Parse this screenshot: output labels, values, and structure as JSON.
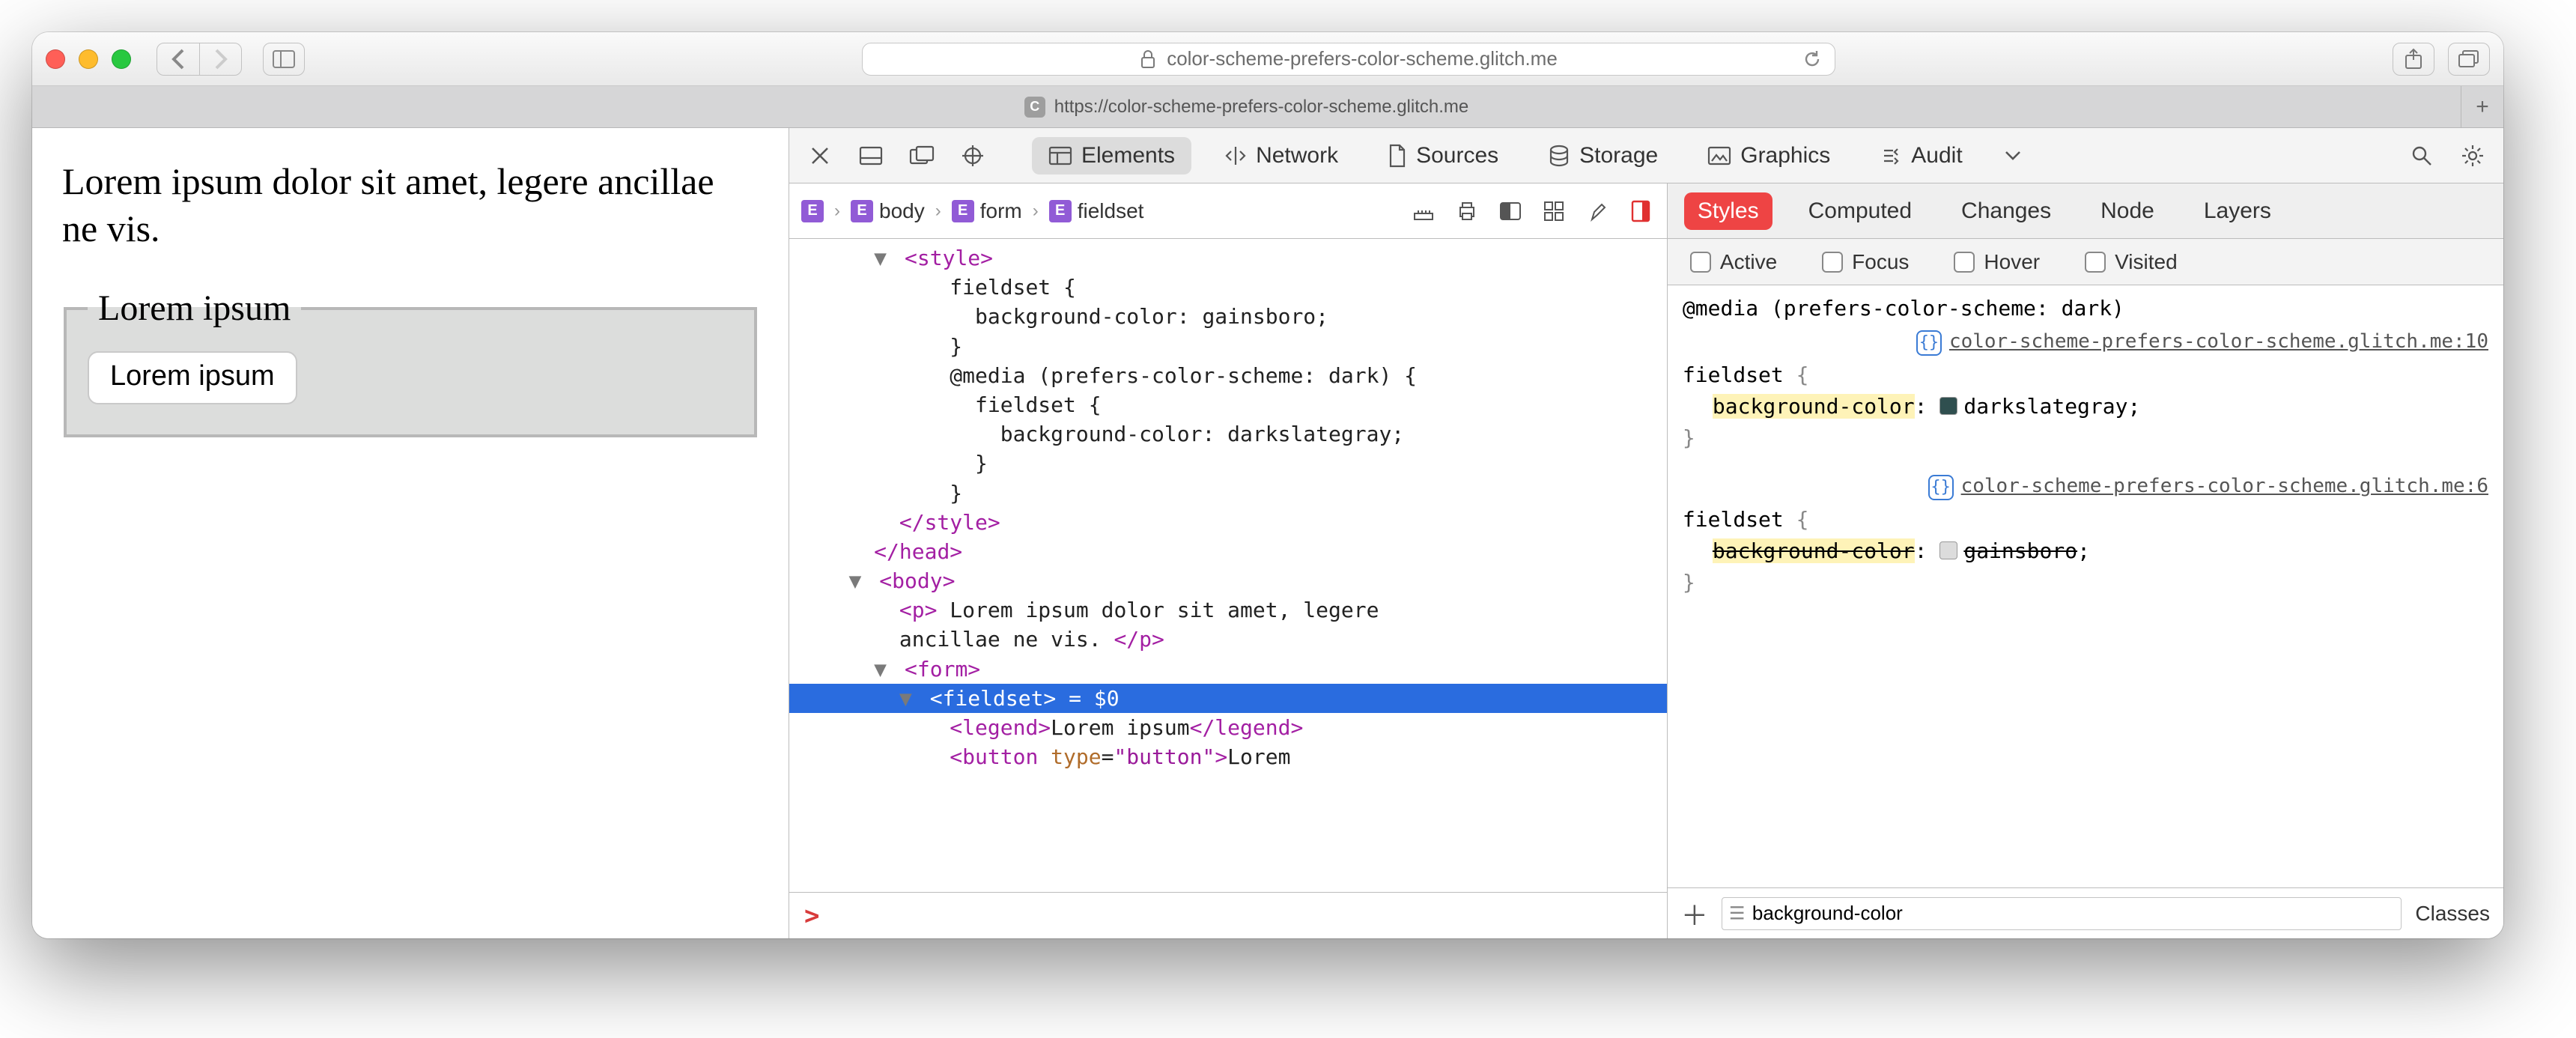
{
  "titlebar": {
    "url_display": "color-scheme-prefers-color-scheme.glitch.me",
    "lock_icon": "lock-icon",
    "reload_icon": "reload-icon"
  },
  "tabstrip": {
    "tab_favicon_letter": "C",
    "tab_label": "https://color-scheme-prefers-color-scheme.glitch.me",
    "newtab": "+"
  },
  "page": {
    "paragraph": "Lorem ipsum dolor sit amet, legere ancillae ne vis.",
    "legend": "Lorem ipsum",
    "button": "Lorem ipsum"
  },
  "devtools": {
    "tabs": {
      "elements": "Elements",
      "network": "Network",
      "sources": "Sources",
      "storage": "Storage",
      "graphics": "Graphics",
      "audit": "Audit"
    },
    "breadcrumb": [
      "body",
      "form",
      "fieldset"
    ],
    "dom_lines": [
      {
        "indent": 3,
        "tri": "▼",
        "html": "<span class='tag'>&lt;style&gt;</span>"
      },
      {
        "indent": 6,
        "html": "<span class='txt'>fieldset {</span>"
      },
      {
        "indent": 7,
        "html": "<span class='txt'>background-color: gainsboro;</span>"
      },
      {
        "indent": 6,
        "html": "<span class='txt'>}</span>"
      },
      {
        "indent": 6,
        "html": "<span class='txt'>@media (prefers-color-scheme: dark) {</span>"
      },
      {
        "indent": 7,
        "html": "<span class='txt'>fieldset {</span>"
      },
      {
        "indent": 8,
        "html": "<span class='txt'>background-color: darkslategray;</span>"
      },
      {
        "indent": 7,
        "html": "<span class='txt'>}</span>"
      },
      {
        "indent": 6,
        "html": "<span class='txt'>}</span>"
      },
      {
        "indent": 4,
        "html": "<span class='tag'>&lt;/style&gt;</span>"
      },
      {
        "indent": 3,
        "html": "<span class='tag'>&lt;/head&gt;</span>"
      },
      {
        "indent": 2,
        "tri": "▼",
        "html": "<span class='tag'>&lt;body&gt;</span>"
      },
      {
        "indent": 4,
        "html": "<span class='tag'>&lt;p&gt;</span><span class='txt'> Lorem ipsum dolor sit amet, legere </span>"
      },
      {
        "indent": 4,
        "html": "<span class='txt'>ancillae ne vis. </span><span class='tag'>&lt;/p&gt;</span>"
      },
      {
        "indent": 3,
        "tri": "▼",
        "html": "<span class='tag'>&lt;form&gt;</span>"
      },
      {
        "indent": 4,
        "tri": "▼",
        "selected": true,
        "html": "<span class='tag'>&lt;fieldset&gt;</span><span class='txt'> = $0</span>"
      },
      {
        "indent": 6,
        "html": "<span class='tag'>&lt;legend&gt;</span><span class='txt'>Lorem ipsum</span><span class='tag'>&lt;/legend&gt;</span>"
      },
      {
        "indent": 6,
        "html": "<span class='tag'>&lt;button </span><span class='attr'>type</span><span class='txt'>=</span><span class='val'>\"button\"</span><span class='tag'>&gt;</span><span class='txt'>Lorem</span>"
      }
    ],
    "console_prompt": ">"
  },
  "styles_panel": {
    "tabs": {
      "styles": "Styles",
      "computed": "Computed",
      "changes": "Changes",
      "node": "Node",
      "layers": "Layers"
    },
    "pseudo": {
      "active": "Active",
      "focus": "Focus",
      "hover": "Hover",
      "visited": "Visited"
    },
    "rule1": {
      "media": "@media (prefers-color-scheme: dark)",
      "source": "color-scheme-prefers-color-scheme.glitch.me:10",
      "selector": "fieldset",
      "prop": "background-color",
      "value": "darkslategray",
      "swatch_color": "#2f4f4f"
    },
    "rule2": {
      "source": "color-scheme-prefers-color-scheme.glitch.me:6",
      "selector": "fieldset",
      "prop": "background-color",
      "value": "gainsboro",
      "swatch_color": "#dcdcdc"
    },
    "filter_value": "background-color",
    "classes_label": "Classes"
  }
}
